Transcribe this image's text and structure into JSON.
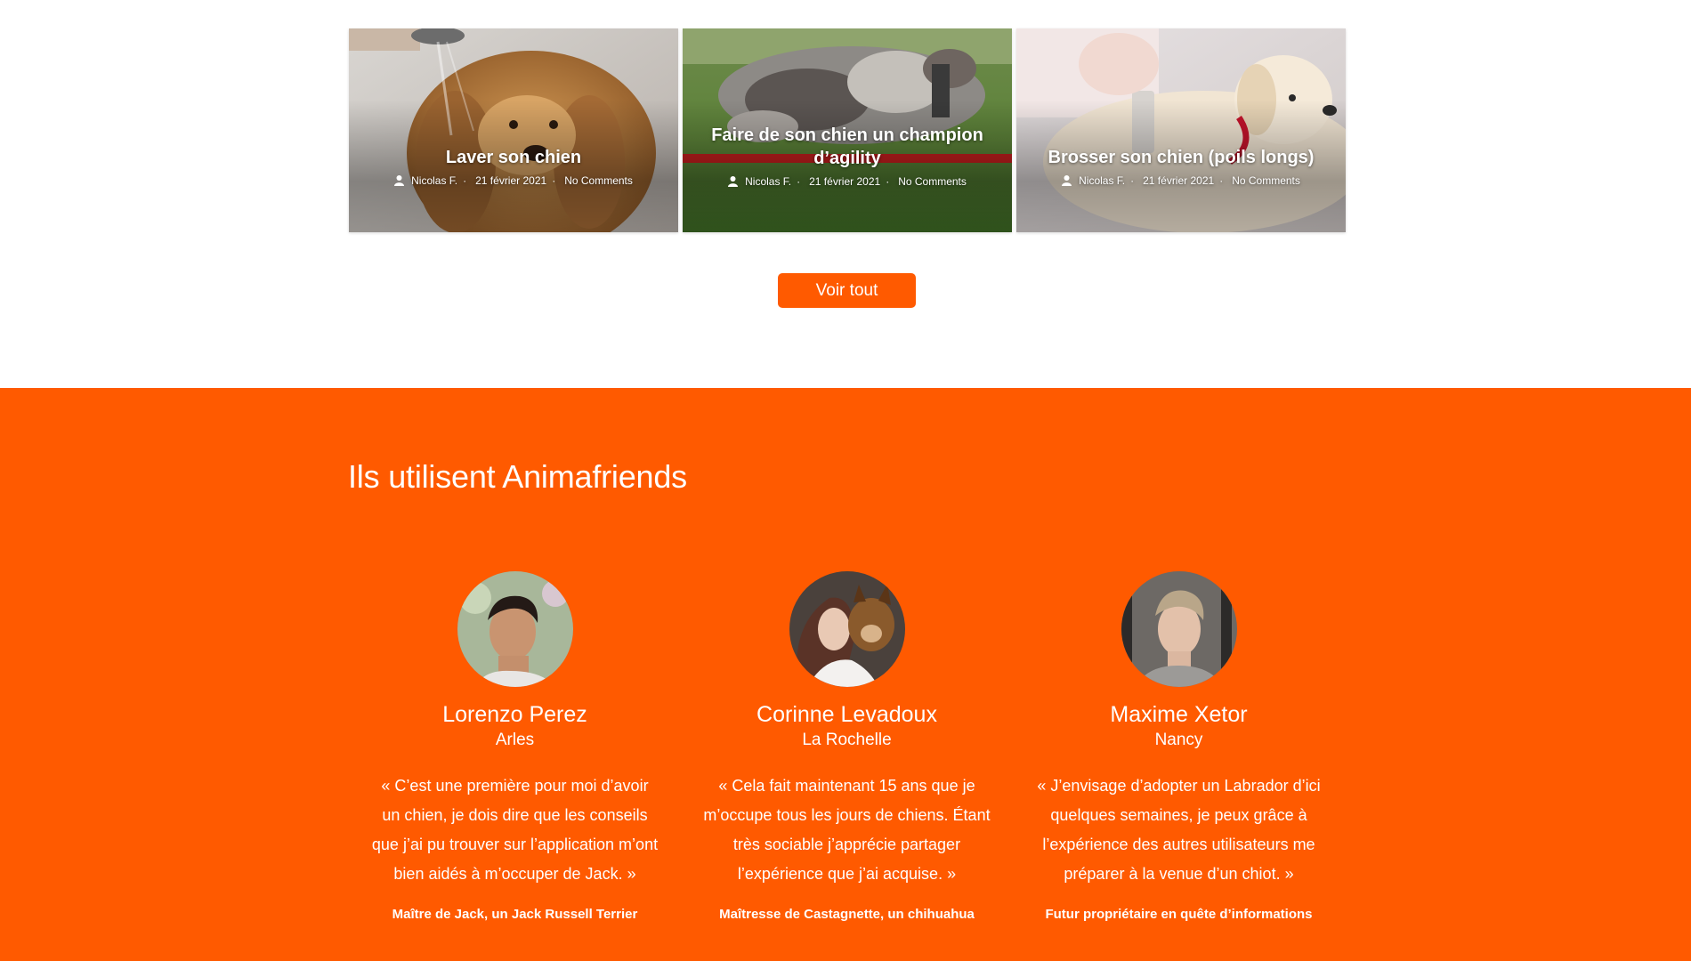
{
  "posts": [
    {
      "title": "Laver son chien",
      "author": "Nicolas F.",
      "date": "21 février 2021",
      "comments": "No Comments",
      "image": "wet golden retriever being showered"
    },
    {
      "title": "Faire de son chien un champion d’agility",
      "author": "Nicolas F.",
      "date": "21 février 2021",
      "comments": "No Comments",
      "image": "australian shepherd jumping agility bar"
    },
    {
      "title": "Brosser son chien (poils longs)",
      "author": "Nicolas F.",
      "date": "21 février 2021",
      "comments": "No Comments",
      "image": "golden retriever being brushed"
    }
  ],
  "meta_separator": "·",
  "see_all_label": "Voir tout",
  "testimonials_title": "Ils utilisent Animafriends",
  "testimonials": [
    {
      "name": "Lorenzo Perez",
      "city": "Arles",
      "quote": "« C’est une première pour moi d’avoir un chien, je dois dire que les conseils que j’ai pu trouver sur l’application m’ont bien aidés à m’occuper de Jack. »",
      "role": "Maître de Jack, un Jack Russell Terrier"
    },
    {
      "name": "Corinne Levadoux",
      "city": "La Rochelle",
      "quote": "« Cela fait maintenant 15 ans que je m’occupe tous les jours de chiens. Étant très sociable j’apprécie partager l’expérience que j’ai acquise. »",
      "role": "Maîtresse de Castagnette, un chihuahua"
    },
    {
      "name": "Maxime Xetor",
      "city": "Nancy",
      "quote": "« J’envisage d’adopter un Labrador d’ici quelques semaines, je peux grâce à l’expérience des autres utilisateurs me préparer à la venue d’un chiot. »",
      "role": "Futur propriétaire en quête d’informations"
    }
  ],
  "colors": {
    "accent": "#ff5a00",
    "text_on_accent": "#ffffff"
  },
  "icons": {
    "author": "user-icon"
  }
}
